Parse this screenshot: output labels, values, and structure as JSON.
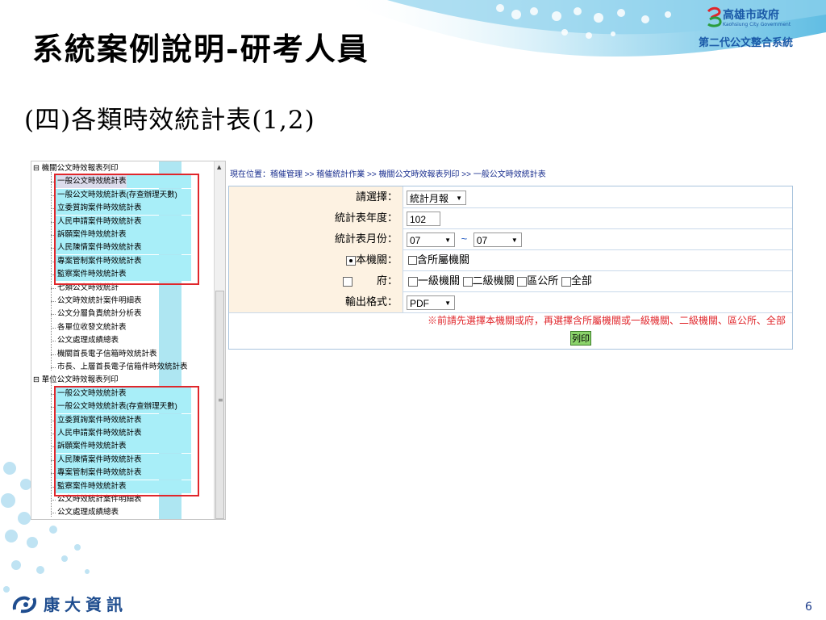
{
  "slide": {
    "title": "系統案例說明-研考人員",
    "subtitle": "(四)各類時效統計表(1,2)",
    "page_number": "6"
  },
  "brand": {
    "city": "高雄市政府",
    "city_en": "Kaohsiung City Government",
    "system": "第二代公文整合系統"
  },
  "footer": {
    "company": "康大資訊"
  },
  "colors": {
    "red_box": "#e0262b",
    "tree_band": "#aee6f2",
    "label_bg": "#fdf2e2",
    "print_button": "#8bd36b",
    "breadcrumb": "#1a2f8f"
  },
  "tree": {
    "group1": {
      "label": "機關公文時效報表列印",
      "items": [
        "一般公文時效統計表",
        "一般公文時效統計表(存查辦理天數)",
        "立委質詢案件時效統計表",
        "人民申請案件時效統計表",
        "訴願案件時效統計表",
        "人民陳情案件時效統計表",
        "專案管制案件時效統計表",
        "監察案件時效統計表",
        "七類公文時效統計",
        "公文時效統計案件明細表",
        "公文分層負責統計分析表",
        "各單位收發文統計表",
        "公文處理成績總表",
        "機關首長電子信箱時效統計表",
        "市長、上層首長電子信箱件時效統計表"
      ]
    },
    "group2": {
      "label": "單位公文時效報表列印",
      "items": [
        "一般公文時效統計表",
        "一般公文時效統計表(存查辦理天數)",
        "立委質詢案件時效統計表",
        "人民申請案件時效統計表",
        "訴願案件時效統計表",
        "人民陳情案件時效統計表",
        "專案管制案件時效統計表",
        "監察案件時效統計表",
        "公文時效統計案件明細表",
        "公文處理成績總表"
      ]
    }
  },
  "breadcrumb": "現在位置：稽催管理 >> 稽催統計作業 >> 機關公文時效報表列印 >> 一般公文時效統計表",
  "form": {
    "select_label": "請選擇：",
    "select_value": "統計月報",
    "year_label": "統計表年度：",
    "year_value": "102",
    "month_label": "統計表月份：",
    "month_from": "07",
    "month_tilde": "~",
    "month_to": "07",
    "agency_radio_label": "本機關：",
    "agency_include_label": "含所屬機關",
    "fu_label": "府：",
    "fu_options": [
      "一級機關",
      "二級機關",
      "區公所",
      "全部"
    ],
    "format_label": "輸出格式：",
    "format_value": "PDF",
    "note": "※前請先選擇本機關或府，再選擇含所屬機關或一級機關、二級機關、區公所、全部",
    "print_button": "列印"
  }
}
